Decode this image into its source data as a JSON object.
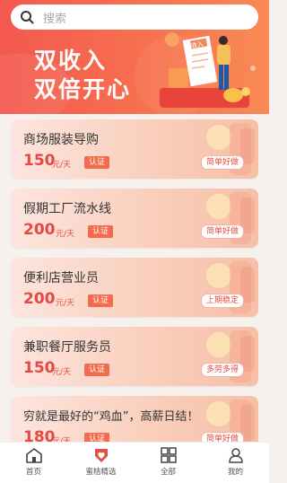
{
  "search": {
    "placeholder": "搜索"
  },
  "banner": {
    "line1": "双收入",
    "line2": "双倍开心",
    "receipt_label": "收入"
  },
  "jobs": [
    {
      "title": "商场服装导购",
      "price": "150",
      "unit": "元/天",
      "cert": "认证",
      "tag": "简单好做"
    },
    {
      "title": "假期工厂流水线",
      "price": "200",
      "unit": "元/天",
      "cert": "认证",
      "tag": "简单好做"
    },
    {
      "title": "便利店营业员",
      "price": "200",
      "unit": "元/天",
      "cert": "认证",
      "tag": "上期稳定"
    },
    {
      "title": "兼职餐厅服务员",
      "price": "150",
      "unit": "元/天",
      "cert": "认证",
      "tag": "多劳多得"
    },
    {
      "title": "穷就是最好的“鸡血”，高薪日结！",
      "price": "180",
      "unit": "元/天",
      "cert": "认证",
      "tag": "简单好做"
    }
  ],
  "tabbar": [
    {
      "label": "首页",
      "icon": "home-icon"
    },
    {
      "label": "蜜桔精选",
      "icon": "heart-badge-icon"
    },
    {
      "label": "全部",
      "icon": "grid-icon"
    },
    {
      "label": "我的",
      "icon": "user-icon"
    }
  ],
  "colors": {
    "accent": "#f4584f",
    "price": "#e34a42",
    "card_bg": "#fbd8cb"
  }
}
